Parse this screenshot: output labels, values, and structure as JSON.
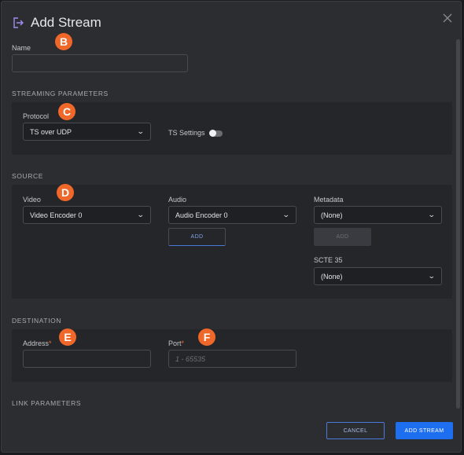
{
  "dialog": {
    "title": "Add Stream",
    "close_icon": "close-icon",
    "title_icon": "stream-export-icon"
  },
  "badges": {
    "b": "B",
    "c": "C",
    "d": "D",
    "e": "E",
    "f": "F"
  },
  "name": {
    "label": "Name",
    "value": "",
    "placeholder": ""
  },
  "streaming_parameters": {
    "heading": "STREAMING PARAMETERS",
    "protocol_label": "Protocol",
    "protocol_value": "TS over UDP",
    "ts_settings_label": "TS Settings",
    "ts_settings_on": false
  },
  "source": {
    "heading": "SOURCE",
    "video_label": "Video",
    "video_value": "Video Encoder 0",
    "audio_label": "Audio",
    "audio_value": "Audio Encoder 0",
    "audio_add": "ADD",
    "metadata_label": "Metadata",
    "metadata_value": "(None)",
    "metadata_add": "ADD",
    "scte35_label": "SCTE 35",
    "scte35_value": "(None)"
  },
  "destination": {
    "heading": "DESTINATION",
    "address_label": "Address",
    "address_value": "",
    "port_label": "Port",
    "port_placeholder": "1 - 65535",
    "required_mark": "*"
  },
  "link_parameters": {
    "heading": "LINK PARAMETERS"
  },
  "footer": {
    "cancel": "CANCEL",
    "add_stream": "ADD STREAM"
  },
  "colors": {
    "accent": "#1e6ff0",
    "badge": "#f0672a",
    "background": "#2c2d31"
  }
}
